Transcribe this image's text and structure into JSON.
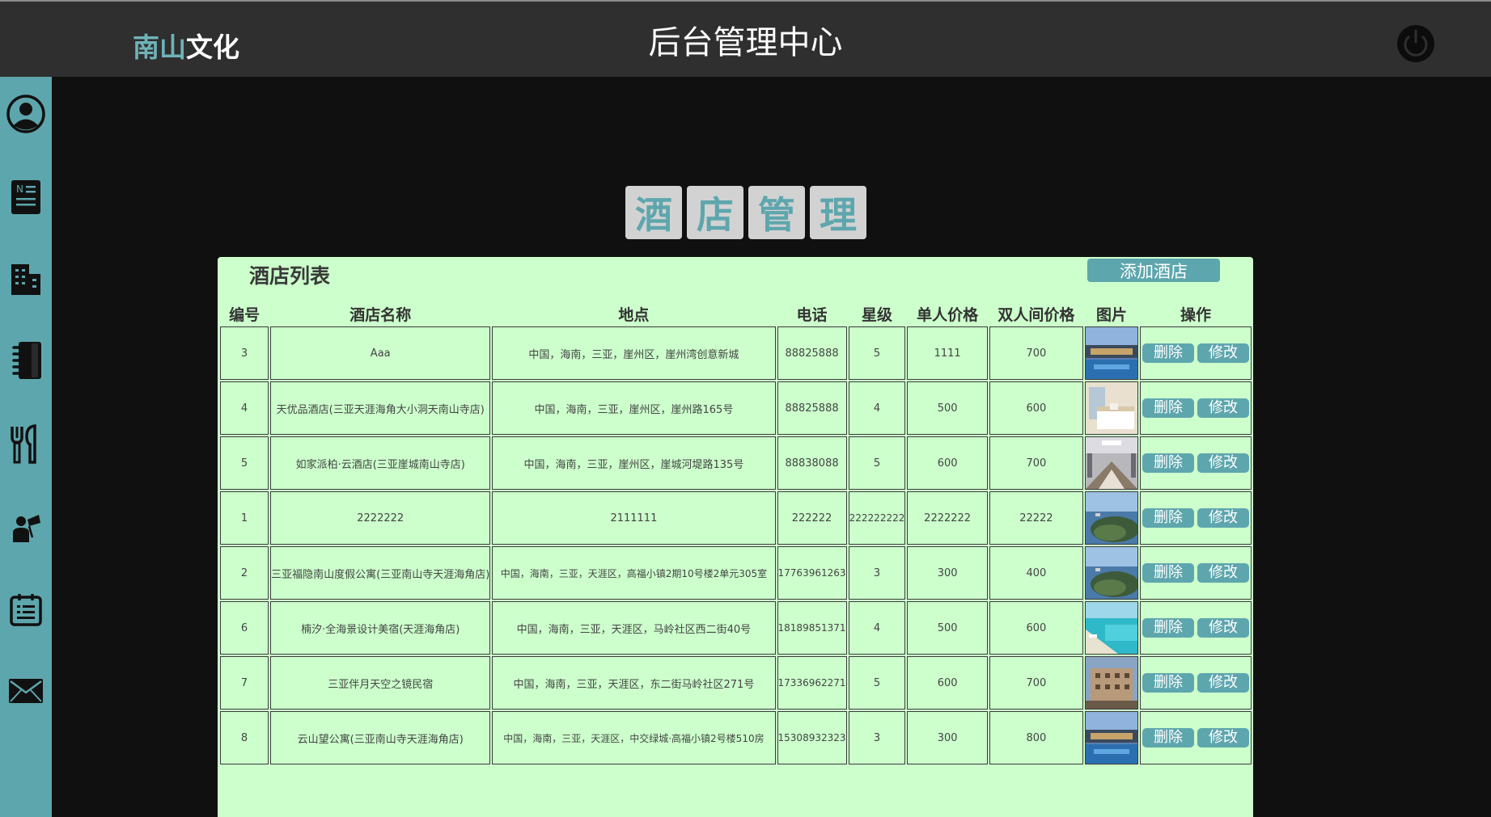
{
  "header": {
    "logo_part1": "南山",
    "logo_part2": "文化",
    "title": "后台管理中心"
  },
  "sidebar": {
    "items": [
      {
        "icon": "user-circle-icon"
      },
      {
        "icon": "news-icon"
      },
      {
        "icon": "building-icon"
      },
      {
        "icon": "notebook-icon"
      },
      {
        "icon": "restaurant-icon"
      },
      {
        "icon": "guide-icon"
      },
      {
        "icon": "message-board-icon"
      },
      {
        "icon": "mail-icon"
      }
    ]
  },
  "page_heading": [
    "酒",
    "店",
    "管",
    "理"
  ],
  "panel": {
    "title": "酒店列表",
    "add_button": "添加酒店",
    "columns": [
      "编号",
      "酒店名称",
      "地点",
      "电话",
      "星级",
      "单人价格",
      "双人间价格",
      "图片",
      "操作"
    ],
    "delete_label": "删除",
    "edit_label": "修改",
    "rows": [
      {
        "id": "3",
        "name": "Aaa",
        "location": "中国，海南，三亚，崖州区，崖州湾创意新城",
        "phone": "88825888",
        "stars": "5",
        "single": "1111",
        "double": "700",
        "img": "resort-pool"
      },
      {
        "id": "4",
        "name": "天优品酒店(三亚天涯海角大小洞天南山寺店)",
        "location": "中国，海南，三亚，崖州区，崖州路165号",
        "phone": "88825888",
        "stars": "4",
        "single": "500",
        "double": "600",
        "img": "bedroom"
      },
      {
        "id": "5",
        "name": "如家派柏·云酒店(三亚崖城南山寺店)",
        "location": "中国，海南，三亚，崖州区，崖城河堤路135号",
        "phone": "88838088",
        "stars": "5",
        "single": "600",
        "double": "700",
        "img": "lobby"
      },
      {
        "id": "1",
        "name": "2222222",
        "location": "2111111",
        "phone": "222222",
        "stars": "222222222",
        "single": "2222222",
        "double": "22222",
        "img": "island"
      },
      {
        "id": "2",
        "name": "三亚福隐南山度假公寓(三亚南山寺天涯海角店)",
        "location": "中国，海南，三亚，天涯区，高福小镇2期10号楼2单元305室",
        "phone": "17763961263",
        "stars": "3",
        "single": "300",
        "double": "400",
        "img": "island"
      },
      {
        "id": "6",
        "name": "楠汐·全海景设计美宿(天涯海角店)",
        "location": "中国，海南，三亚，天涯区，马岭社区西二街40号",
        "phone": "18189851371",
        "stars": "4",
        "single": "500",
        "double": "600",
        "img": "beach-pool"
      },
      {
        "id": "7",
        "name": "三亚伴月天空之镜民宿",
        "location": "中国，海南，三亚，天涯区，东二街马岭社区271号",
        "phone": "17336962271",
        "stars": "5",
        "single": "600",
        "double": "700",
        "img": "hotel-building"
      },
      {
        "id": "8",
        "name": "云山望公寓(三亚南山寺天涯海角店)",
        "location": "中国，海南，三亚，天涯区，中交绿城·高福小镇2号楼510房",
        "phone": "15308932323",
        "stars": "3",
        "single": "300",
        "double": "800",
        "img": "resort-pool"
      }
    ]
  },
  "colors": {
    "header_bg": "#2f2f2f",
    "sidebar_bg": "#5ea6ad",
    "panel_bg": "#ccffcc",
    "accent": "#5ea6ad",
    "page_bg": "#101010"
  }
}
